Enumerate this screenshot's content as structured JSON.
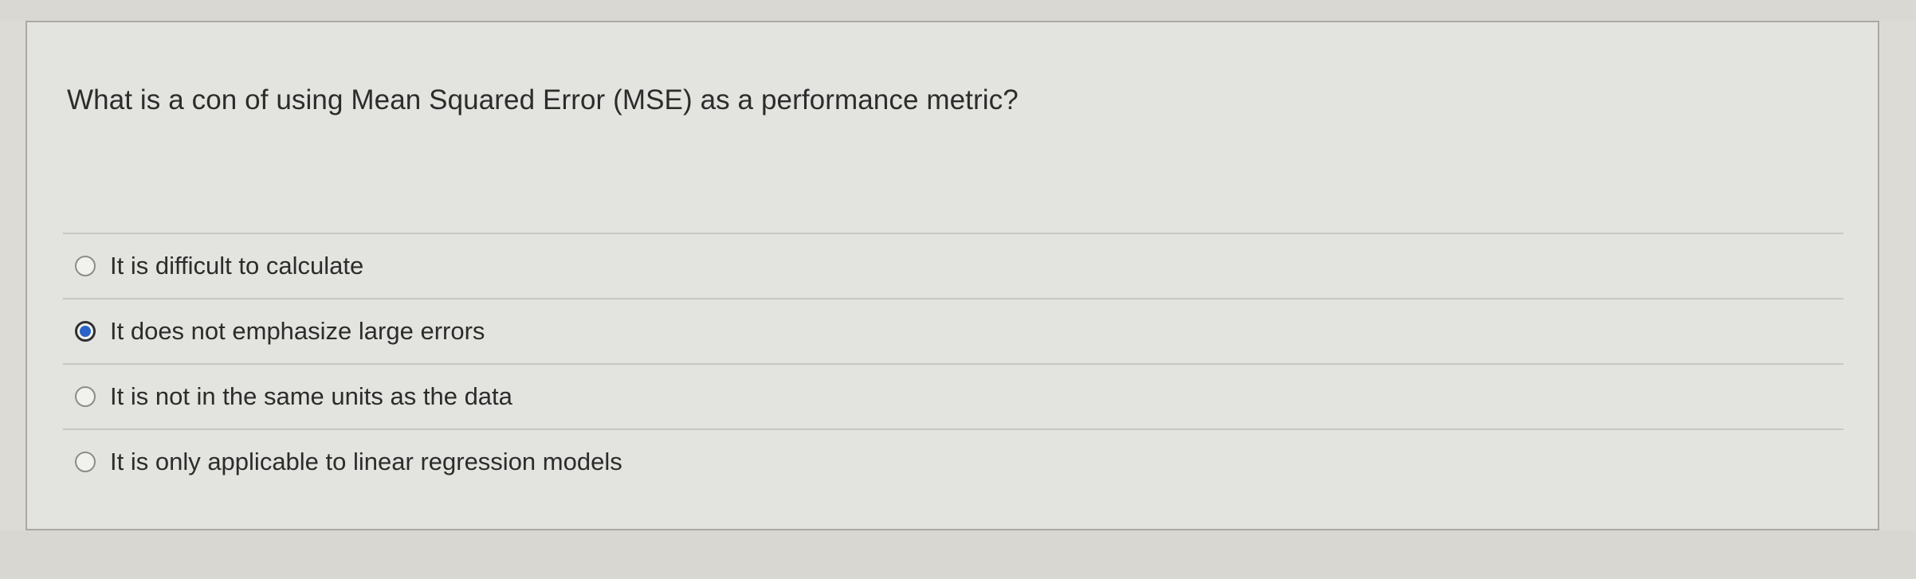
{
  "question": {
    "text": "What is a con of using Mean Squared Error (MSE) as a performance metric?"
  },
  "options": [
    {
      "label": "It is difficult to calculate",
      "selected": false
    },
    {
      "label": "It does not emphasize large errors",
      "selected": true
    },
    {
      "label": "It is not in the same units as the data",
      "selected": false
    },
    {
      "label": "It is only applicable to linear regression models",
      "selected": false
    }
  ],
  "colors": {
    "page_background": "#dcdbd6",
    "card_background": "#e3e3df",
    "card_border": "#a9a9a5",
    "radio_selected_fill": "#2a62c8",
    "text": "#2c2c2c"
  }
}
